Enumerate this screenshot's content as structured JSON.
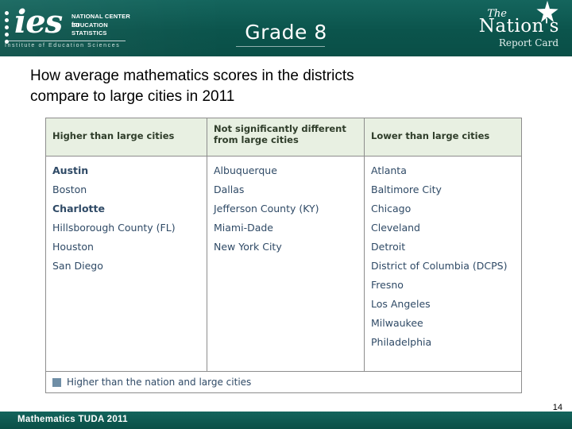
{
  "header": {
    "logo": {
      "ies_word": "ies",
      "line1": "NATIONAL CENTER for",
      "line2": "EDUCATION STATISTICS",
      "tagline": "Institute of Education Sciences"
    },
    "grade_title": "Grade 8",
    "report_card": {
      "the": "The",
      "nation": "Nation's",
      "report": "Report Card"
    },
    "bg_color": "#0d5c55"
  },
  "slide": {
    "title_line1": "How average mathematics scores in the districts",
    "title_line2": "compare to large cities in 2011"
  },
  "table": {
    "headers": [
      "Higher than large cities",
      "Not significantly different from large cities",
      "Lower than large cities"
    ],
    "header_c2_line1": "Not significantly different",
    "header_c2_line2": "from large cities",
    "columns": [
      [
        {
          "label": "Austin",
          "bold": true
        },
        {
          "label": "Boston",
          "bold": false
        },
        {
          "label": "Charlotte",
          "bold": true
        },
        {
          "label": "Hillsborough County (FL)",
          "bold": false
        },
        {
          "label": "Houston",
          "bold": false
        },
        {
          "label": "San Diego",
          "bold": false
        }
      ],
      [
        {
          "label": "Albuquerque",
          "bold": false
        },
        {
          "label": "Dallas",
          "bold": false
        },
        {
          "label": "Jefferson County (KY)",
          "bold": false
        },
        {
          "label": "Miami-Dade",
          "bold": false
        },
        {
          "label": "New York City",
          "bold": false
        }
      ],
      [
        {
          "label": "Atlanta",
          "bold": false
        },
        {
          "label": "Baltimore City",
          "bold": false
        },
        {
          "label": "Chicago",
          "bold": false
        },
        {
          "label": "Cleveland",
          "bold": false
        },
        {
          "label": "Detroit",
          "bold": false
        },
        {
          "label": "District of Columbia (DCPS)",
          "bold": false
        },
        {
          "label": "Fresno",
          "bold": false
        },
        {
          "label": "Los Angeles",
          "bold": false
        },
        {
          "label": "Milwaukee",
          "bold": false
        },
        {
          "label": "Philadelphia",
          "bold": false
        }
      ]
    ],
    "legend": {
      "text": "Higher than the nation and large cities",
      "swatch_color": "#6f8ea6"
    },
    "header_bg_color": "#e8f0e2",
    "text_color": "#2f4a66"
  },
  "footer": {
    "label": "Mathematics TUDA 2011",
    "page_number": "14"
  }
}
